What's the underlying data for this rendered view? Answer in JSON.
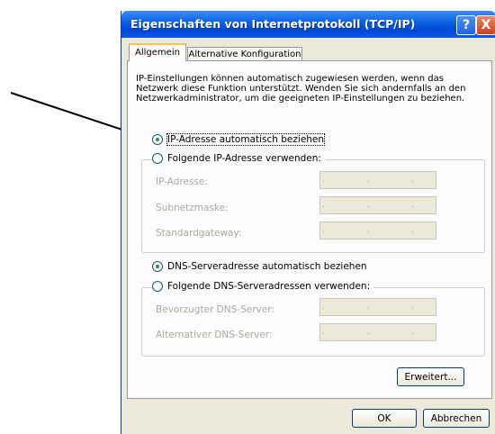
{
  "window": {
    "title": "Eigenschaften von Internetprotokoll (TCP/IP)",
    "help_label": "?",
    "close_label": "X"
  },
  "tabs": [
    {
      "label": "Allgemein"
    },
    {
      "label": "Alternative Konfiguration"
    }
  ],
  "description": "IP-Einstellungen können automatisch zugewiesen werden, wenn das Netzwerk diese Funktion unterstützt. Wenden Sie sich andernfalls an den Netzwerkadministrator, um die geeigneten IP-Einstellungen zu beziehen.",
  "ip": {
    "auto_label": "IP-Adresse automatisch beziehen",
    "manual_label": "Folgende IP-Adresse verwenden:",
    "fields": [
      {
        "label": "IP-Adresse:",
        "value": ". . ."
      },
      {
        "label": "Subnetzmaske:",
        "value": ". . ."
      },
      {
        "label": "Standardgateway:",
        "value": ". . ."
      }
    ]
  },
  "dns": {
    "auto_label": "DNS-Serveradresse automatisch beziehen",
    "manual_label": "Folgende DNS-Serveradressen verwenden:",
    "fields": [
      {
        "label": "Bevorzugter DNS-Server:",
        "value": ". . ."
      },
      {
        "label": "Alternativer DNS-Server:",
        "value": ". . ."
      }
    ]
  },
  "buttons": {
    "advanced": "Erweitert...",
    "ok": "OK",
    "cancel": "Abbrechen"
  }
}
